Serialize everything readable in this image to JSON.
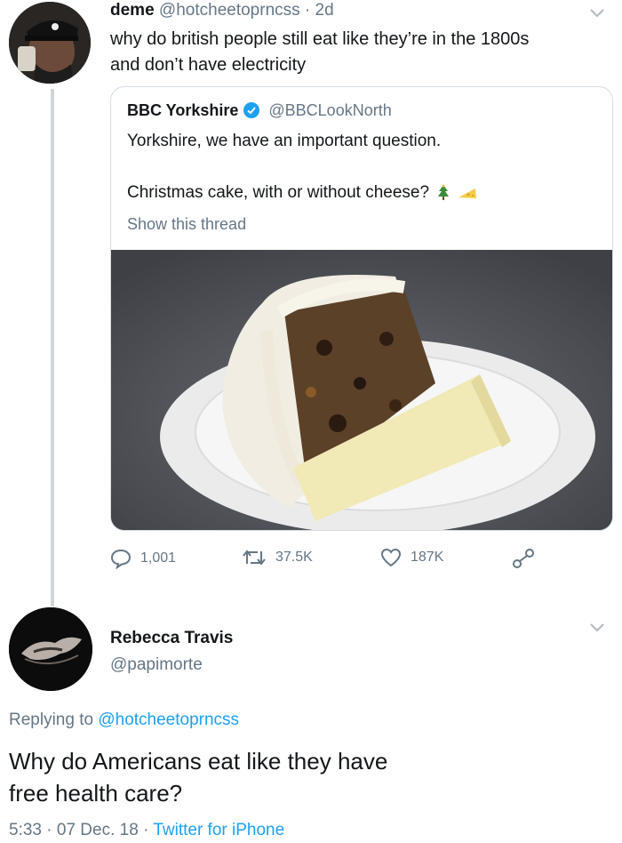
{
  "tweet1": {
    "name": "deme",
    "handle": "@hotcheetoprncss",
    "sep": "·",
    "age": "2d",
    "text_line1": "why do british people still eat like they’re in the 1800s",
    "text_line2": "and don’t have electricity"
  },
  "quote": {
    "name": "BBC Yorkshire",
    "handle": "@BBCLookNorth",
    "text_line1": "Yorkshire, we have an important question.",
    "text_line2": "Christmas cake, with or without cheese?",
    "show_thread": "Show this thread",
    "image_alt": "Christmas cake slice with cheese on a paper plate"
  },
  "actions": {
    "replies": "1,001",
    "retweets": "37.5K",
    "likes": "187K"
  },
  "tweet2": {
    "name": "Rebecca Travis",
    "handle": "@papimorte",
    "replying_prefix": "Replying to",
    "replying_handle": "@hotcheetoprncss",
    "text_line1": "Why do Americans eat like they have",
    "text_line2": "free health care?",
    "time": "5:33",
    "sep1": "·",
    "date": "07 Dec. 18",
    "sep2": "·",
    "source": "Twitter for iPhone"
  },
  "colors": {
    "accent": "#1da1f2",
    "muted": "#657786",
    "text": "#14171a",
    "border": "#d6dde2"
  }
}
